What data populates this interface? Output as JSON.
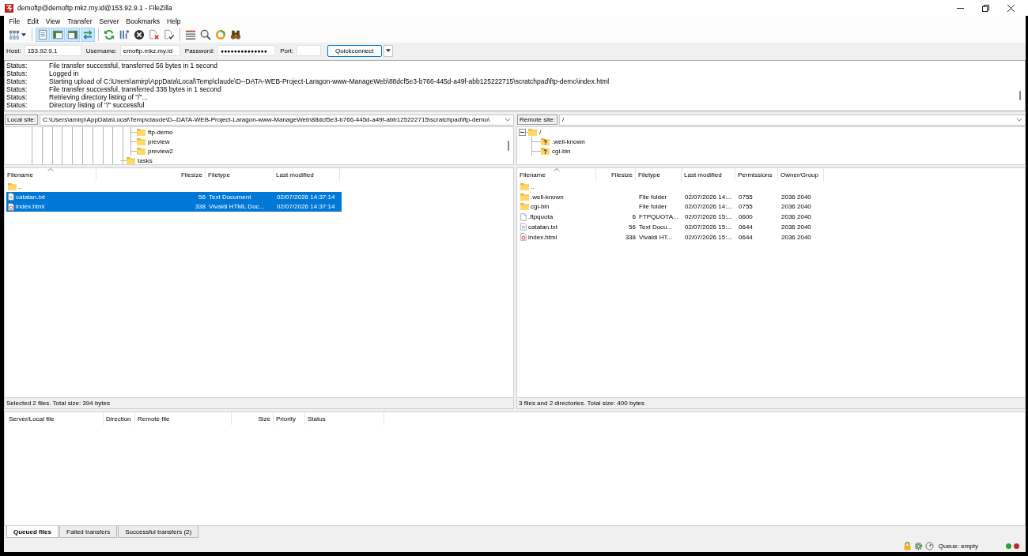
{
  "window": {
    "title": "demoftp@demoftp.mkz.my.id@153.92.9.1 - FileZilla"
  },
  "menu": [
    "File",
    "Edit",
    "View",
    "Transfer",
    "Server",
    "Bookmarks",
    "Help"
  ],
  "toolbar": {
    "groups": [
      {
        "buttons": [
          {
            "on": false
          }
        ]
      },
      {
        "buttons": [
          {
            "on": true
          },
          {
            "on": true
          },
          {
            "on": true
          },
          {
            "on": true
          }
        ]
      },
      {
        "buttons": [
          {
            "on": false
          },
          {
            "on": false
          },
          {
            "on": false
          },
          {
            "on": false
          },
          {
            "on": false
          }
        ]
      },
      {
        "buttons": [
          {
            "on": false
          },
          {
            "on": false
          },
          {
            "on": false
          },
          {
            "on": false
          }
        ]
      }
    ]
  },
  "quickconnect": {
    "fields": [
      {
        "label": "Host:",
        "value": "153.92.9.1"
      },
      {
        "label": "Username:",
        "value": "emoftp.mkz.my.id"
      },
      {
        "label": "Password:",
        "value": "●●●●●●●●●●●●●●"
      },
      {
        "label": "Port:"
      }
    ],
    "button": "Quickconnect"
  },
  "message_log": [
    {
      "label": "Status:",
      "message": "File transfer successful, transferred 56 bytes in 1 second"
    },
    {
      "label": "Status:",
      "message": "Logged in"
    },
    {
      "label": "Status:",
      "message": "Starting upload of C:\\Users\\amirp\\AppData\\Local\\Temp\\claude\\D--DATA-WEB-Project-Laragon-www-ManageWeb\\88dcf5e3-b766-445d-a49f-abb125222715\\scratchpad\\ftp-demo\\index.html"
    },
    {
      "label": "Status:",
      "message": "File transfer successful, transferred 338 bytes in 1 second"
    },
    {
      "label": "Status:",
      "message": "Retrieving directory listing of \"/\"..."
    },
    {
      "label": "Status:",
      "message": "Directory listing of \"/\" successful"
    }
  ],
  "local": {
    "site_label": "Local site:",
    "path": "C:\\Users\\amirp\\AppData\\Local\\Temp\\claude\\D--DATA-WEB-Project-Laragon-www-ManageWeb\\88dcf5e3-b766-445d-a49f-abb125222715\\scratchpad\\ftp-demo\\",
    "tree": [
      {
        "children": [
          {
            "label": "ftp-demo",
            "kind": "folder"
          },
          {
            "label": "preview",
            "kind": "folder"
          },
          {
            "label": "preview2",
            "kind": "folder"
          }
        ]
      },
      {
        "label": "tasks",
        "kind": "folder"
      }
    ],
    "columns": [
      "Filename",
      "Filesize",
      "Filetype",
      "Last modified"
    ],
    "rows": [
      {
        "name": "..",
        "kind": "parent",
        "selected": false
      },
      {
        "name": "catatan.txt",
        "size": "56",
        "type": "Text Document",
        "modified": "02/07/2026 14:37:14",
        "kind": "text",
        "selected": true
      },
      {
        "name": "index.html",
        "size": "338",
        "type": "Vivaldi HTML Doc...",
        "modified": "02/07/2026 14:37:14",
        "kind": "html",
        "selected": true
      }
    ],
    "status": "Selected 2 files. Total size: 394 bytes"
  },
  "remote": {
    "site_label": "Remote site:",
    "path": "/",
    "tree": [
      {
        "label": "/",
        "kind": "folder",
        "expanded": true,
        "children": [
          {
            "label": ".well-known",
            "kind": "unknown"
          },
          {
            "label": "cgi-bin",
            "kind": "unknown"
          }
        ]
      }
    ],
    "columns": [
      "Filename",
      "Filesize",
      "Filetype",
      "Last modified",
      "Permissions",
      "Owner/Group"
    ],
    "rows": [
      {
        "name": "..",
        "kind": "parent",
        "selected": false
      },
      {
        "name": ".well-known",
        "type": "File folder",
        "modified": "02/07/2026 14:...",
        "permissions": "0755",
        "owner_group": "2036 2040",
        "kind": "folder",
        "selected": false
      },
      {
        "name": "cgi-bin",
        "type": "File folder",
        "modified": "02/07/2026 14:...",
        "permissions": "0755",
        "owner_group": "2036 2040",
        "kind": "folder",
        "selected": false
      },
      {
        "name": ".ftpquota",
        "size": "6",
        "type": "FTPQUOTA...",
        "modified": "02/07/2026 15:...",
        "permissions": "0600",
        "owner_group": "2036 2040",
        "kind": "file",
        "selected": false
      },
      {
        "name": "catatan.txt",
        "size": "56",
        "type": "Text Docu...",
        "modified": "02/07/2026 15:...",
        "permissions": "0644",
        "owner_group": "2036 2040",
        "kind": "text",
        "selected": false
      },
      {
        "name": "index.html",
        "size": "338",
        "type": "Vivaldi HT...",
        "modified": "02/07/2026 15:...",
        "permissions": "0644",
        "owner_group": "2036 2040",
        "kind": "html",
        "selected": false
      }
    ],
    "status": "3 files and 2 directories. Total size: 400 bytes"
  },
  "queue": {
    "columns": [
      "Server/Local file",
      "Direction",
      "Remote file",
      "Size",
      "Priority",
      "Status"
    ]
  },
  "queue_tabs": [
    {
      "label": "Queued files",
      "selected": true
    },
    {
      "label": "Failed transfers",
      "selected": false
    },
    {
      "label": "Successful transfers (2)",
      "selected": false
    }
  ],
  "status_bar": {
    "queue": "Queue: empty",
    "lights": [
      {
        "color": "#2f9e3a"
      },
      {
        "color": "#c62828"
      }
    ]
  }
}
